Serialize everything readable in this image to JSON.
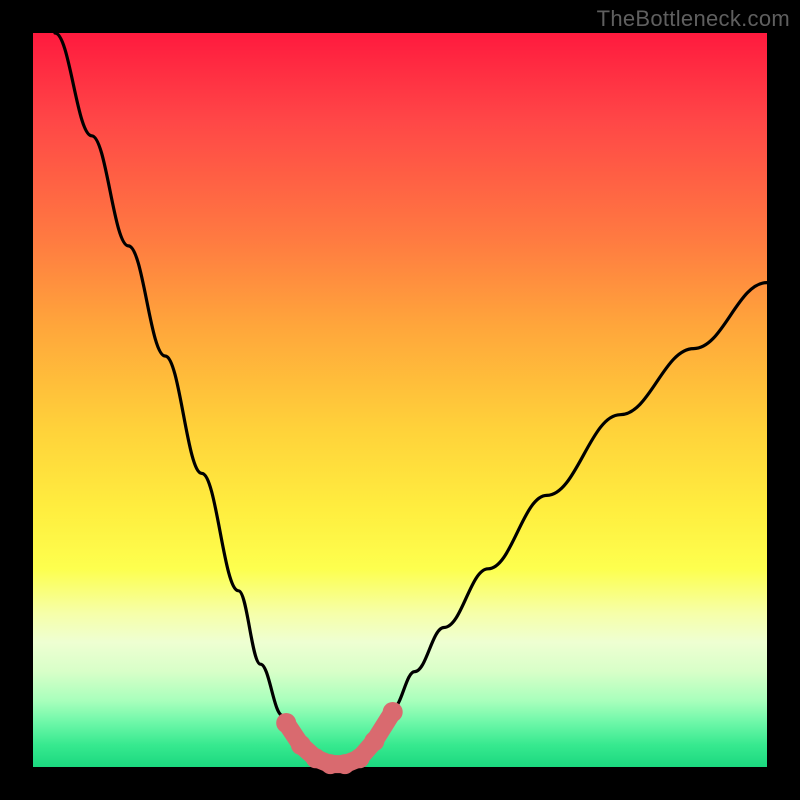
{
  "watermark": "TheBottleneck.com",
  "colors": {
    "frame": "#000000",
    "curve_stroke": "#000000",
    "marker_fill": "#d96a6f",
    "marker_stroke": "#d96a6f"
  },
  "chart_data": {
    "type": "line",
    "title": "",
    "xlabel": "",
    "ylabel": "",
    "xlim": [
      0,
      1
    ],
    "ylim": [
      0,
      1
    ],
    "grid": false,
    "series": [
      {
        "name": "bottleneck-curve",
        "x": [
          0.03,
          0.08,
          0.13,
          0.18,
          0.23,
          0.28,
          0.31,
          0.34,
          0.36,
          0.38,
          0.4,
          0.42,
          0.44,
          0.46,
          0.49,
          0.52,
          0.56,
          0.62,
          0.7,
          0.8,
          0.9,
          1.0
        ],
        "y": [
          1.0,
          0.86,
          0.71,
          0.56,
          0.4,
          0.24,
          0.14,
          0.07,
          0.035,
          0.015,
          0.003,
          0.003,
          0.015,
          0.035,
          0.08,
          0.13,
          0.19,
          0.27,
          0.37,
          0.48,
          0.57,
          0.66
        ]
      }
    ],
    "markers": {
      "name": "bottom-highlight",
      "x": [
        0.345,
        0.365,
        0.385,
        0.405,
        0.425,
        0.445,
        0.465,
        0.49
      ],
      "y": [
        0.06,
        0.03,
        0.012,
        0.004,
        0.004,
        0.012,
        0.035,
        0.075
      ]
    }
  }
}
